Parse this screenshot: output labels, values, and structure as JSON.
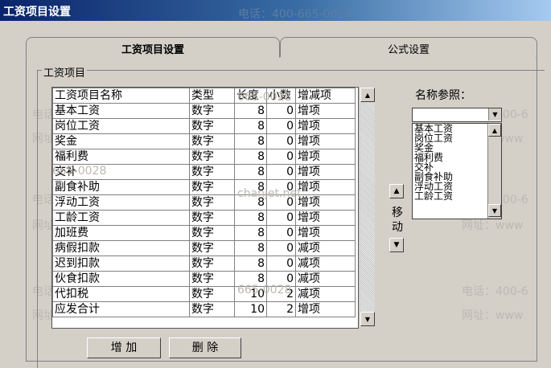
{
  "window": {
    "title": "工资项目设置"
  },
  "watermarks": {
    "phone": "电话：400-665-0028",
    "phone_short": "电话：400-6",
    "site": "网址：www.chanjet.com",
    "site_short": "网址：www",
    "site_mid": "网址：www.chanjet.net",
    "frag1": "665-0028",
    "frag2": "chanjet.net"
  },
  "tabs": [
    {
      "label": "工资项目设置"
    },
    {
      "label": "公式设置"
    }
  ],
  "group": {
    "label": "工资项目"
  },
  "grid": {
    "columns": [
      "工资项目名称",
      "类型",
      "长度",
      "小数",
      "增减项"
    ],
    "rows": [
      [
        "基本工资",
        "数字",
        "8",
        "0",
        "增项"
      ],
      [
        "岗位工资",
        "数字",
        "8",
        "0",
        "增项"
      ],
      [
        "奖金",
        "数字",
        "8",
        "0",
        "增项"
      ],
      [
        "福利费",
        "数字",
        "8",
        "0",
        "增项"
      ],
      [
        "交补",
        "数字",
        "8",
        "0",
        "增项"
      ],
      [
        "副食补助",
        "数字",
        "8",
        "0",
        "增项"
      ],
      [
        "浮动工资",
        "数字",
        "8",
        "0",
        "增项"
      ],
      [
        "工龄工资",
        "数字",
        "8",
        "0",
        "增项"
      ],
      [
        "加班费",
        "数字",
        "8",
        "0",
        "增项"
      ],
      [
        "病假扣款",
        "数字",
        "8",
        "0",
        "减项"
      ],
      [
        "迟到扣款",
        "数字",
        "8",
        "0",
        "减项"
      ],
      [
        "伙食扣款",
        "数字",
        "8",
        "0",
        "减项"
      ],
      [
        "代扣税",
        "数字",
        "10",
        "2",
        "减项"
      ],
      [
        "应发合计",
        "数字",
        "10",
        "2",
        "增项"
      ]
    ]
  },
  "move": {
    "char1": "移",
    "char2": "动"
  },
  "name_ref": {
    "label": "名称参照：",
    "value": "",
    "items": [
      "基本工资",
      "岗位工资",
      "奖金",
      "福利费",
      "交补",
      "副食补助",
      "浮动工资",
      "工龄工资"
    ]
  },
  "buttons": {
    "add": "增 加",
    "delete": "删 除"
  }
}
